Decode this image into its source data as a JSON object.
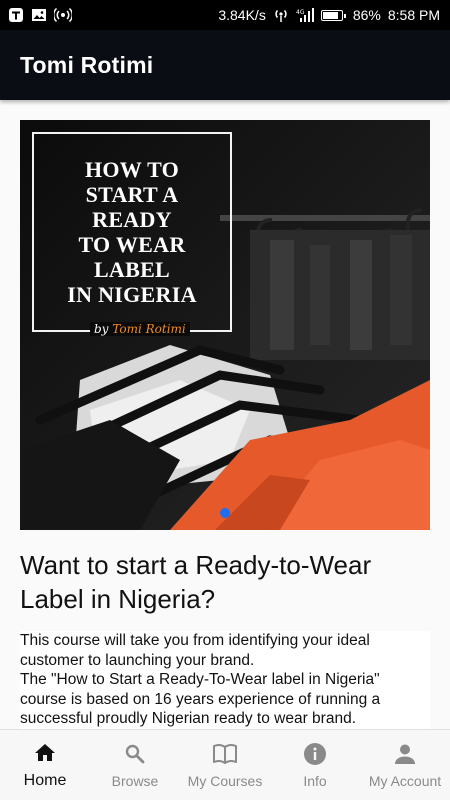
{
  "status_bar": {
    "speed": "3.84K/s",
    "battery": "86%",
    "battery_level": 0.86,
    "time": "8:58 PM"
  },
  "app_bar": {
    "title": "Tomi Rotimi"
  },
  "carousel": {
    "title_lines": [
      "HOW TO",
      "START A",
      "READY",
      "TO WEAR",
      "LABEL",
      "IN NIGERIA"
    ],
    "byline_prefix": "by",
    "byline_name": "Tomi Rotimi",
    "current_slide": 1
  },
  "course": {
    "headline": "Want to start a Ready-to-Wear Label in Nigeria?",
    "description": [
      "This course will take you from identifying your ideal customer to launching your brand.",
      "The \"How to Start a Ready-To-Wear label in Nigeria\" course is based on 16 years experience of running a successful proudly Nigerian ready to wear brand."
    ]
  },
  "bottom_nav": {
    "items": [
      {
        "label": "Home",
        "icon": "home-icon",
        "active": true
      },
      {
        "label": "Browse",
        "icon": "search-icon",
        "active": false
      },
      {
        "label": "My Courses",
        "icon": "book-icon",
        "active": false
      },
      {
        "label": "Info",
        "icon": "info-icon",
        "active": false
      },
      {
        "label": "My Account",
        "icon": "person-icon",
        "active": false
      }
    ]
  },
  "colors": {
    "app_bar": "#0a0d14",
    "accent": "#1e6ef0",
    "byline_name": "#f08a2a",
    "active_nav": "#111111",
    "inactive_nav": "#8a8a8a"
  }
}
